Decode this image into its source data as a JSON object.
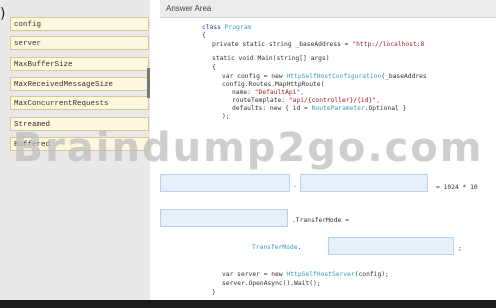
{
  "source_bank": {
    "items": [
      "config",
      "server",
      "MaxBufferSize",
      "MaxReceivedMessageSize",
      "MaxConcurrentRequests",
      "Streamed",
      "Buffered"
    ]
  },
  "answer_area": {
    "title": "Answer Area",
    "code": {
      "line1_kw": "class ",
      "line1_ty": "Program",
      "line2": "{",
      "line3_a": "private static string _baseAddress = ",
      "line3_str": "\"http://localhost:8",
      "line4_a": "static void Main(string[] args)",
      "line5": "{",
      "line6_a": "var config = new ",
      "line6_ty": "HttpSelfHostConfiguration",
      "line6_b": "(_baseAddres",
      "line7": "config.Routes.MapHttpRoute(",
      "line8_a": "name: ",
      "line8_str": "\"DefaultApi\",",
      "line9_a": "routeTemplate: ",
      "line9_str": "\"api/{controller}/{id}\",",
      "line10_a": "defaults: new { id = ",
      "line10_ty": "RouteParameter",
      "line10_b": ".Optional }",
      "line11": ");",
      "dot": ".",
      "assign_tail": "= 1024 * 10",
      "transfer_mode": ".TransferMode =",
      "transfer_mode_enum": "TransferMode",
      "transfer_mode_dot": ".",
      "semicolon": ";",
      "server_a": "var server = new ",
      "server_ty": "HttpSelfHostServer",
      "server_b": "(config);",
      "open_async": "server.OpenAsync().Wait();",
      "close": "}"
    }
  },
  "watermark": "Braindump2go.com"
}
